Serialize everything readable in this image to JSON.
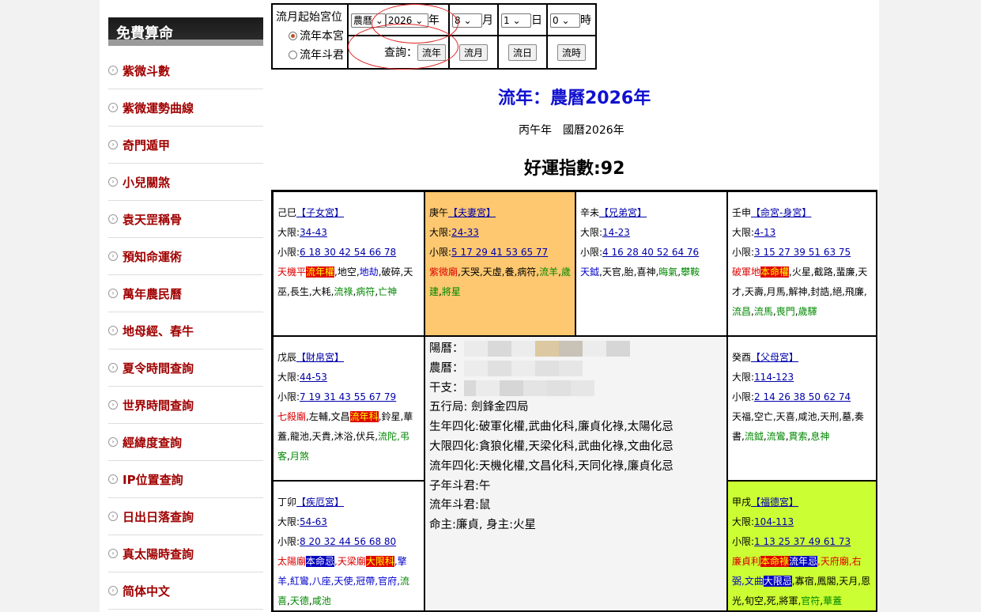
{
  "sidebar": {
    "title": "免費算命",
    "items": [
      "紫微斗數",
      "紫微運勢曲線",
      "奇門遁甲",
      "小兒關煞",
      "袁天罡稱骨",
      "預知命運術",
      "萬年農民曆",
      "地母經、春牛",
      "夏令時間查詢",
      "世界時間查詢",
      "經緯度查詢",
      "IP位置查詢",
      "日出日落查詢",
      "真太陽時查詢",
      "简体中文"
    ]
  },
  "controls": {
    "start_label": "流月起始宮位",
    "radio1": "流年本宮",
    "radio2": "流年斗君",
    "calendar": "農曆",
    "year": "2026",
    "year_unit": "年",
    "month": "8",
    "month_unit": "月",
    "day": "1",
    "day_unit": "日",
    "hour": "0",
    "hour_unit": "時",
    "query_label": "查詢：",
    "btn_year": "流年",
    "btn_month": "流月",
    "btn_day": "流日",
    "btn_hour": "流時"
  },
  "header": {
    "title": "流年：農曆2026年",
    "sub": "丙午年　國曆2026年",
    "score": "好運指數:92"
  },
  "palaces": {
    "p1": {
      "stem": "己巳",
      "name": "【子女宮】",
      "daxian": "34-43",
      "xiaoxian": "6 18 30 42 54 66 78"
    },
    "p2": {
      "stem": "庚午",
      "name": "【夫妻宮】",
      "daxian": "24-33",
      "xiaoxian": "5 17 29 41 53 65 77"
    },
    "p3": {
      "stem": "辛未",
      "name": "【兄弟宮】",
      "daxian": "14-23",
      "xiaoxian": "4 16 28 40 52 64 76"
    },
    "p4": {
      "stem": "壬申",
      "name": "【命宮-身宮】",
      "daxian": "4-13",
      "xiaoxian": "3 15 27 39 51 63 75"
    },
    "p5": {
      "stem": "戊辰",
      "name": "【財帛宮】",
      "daxian": "44-53",
      "xiaoxian": "7 19 31 43 55 67 79"
    },
    "p6": {
      "stem": "癸酉",
      "name": "【父母宮】",
      "daxian": "114-123",
      "xiaoxian": "2 14 26 38 50 62 74"
    },
    "p7": {
      "stem": "丁卯",
      "name": "【疾厄宮】",
      "daxian": "54-63",
      "xiaoxian": "8 20 32 44 56 68 80"
    },
    "p8": {
      "stem": "甲戌",
      "name": "【福德宮】",
      "daxian": "104-113",
      "xiaoxian": "1 13 25 37 49 61 73"
    }
  },
  "labels": {
    "daxian": "大限:",
    "xiaoxian": "小限:"
  },
  "stars": {
    "p1_a": "天機平",
    "p1_b": "流年權",
    "p1_c": ",地空,",
    "p1_d": "地劫",
    "p1_e": ",破碎,天",
    "p1_f": "巫,長生,大耗,",
    "p1_g": "流祿",
    "p1_h": ",",
    "p1_i": "病符",
    "p1_j": ",",
    "p1_k": "亡神",
    "p2_a": "紫微廟",
    "p2_b": ",天哭,天虛,養,病符,",
    "p2_c": "流羊",
    "p2_d": ",",
    "p2_e": "歲建",
    "p2_f": ",",
    "p2_g": "將星",
    "p3_a": "天鉞",
    "p3_b": ",天官,胎,喜神,",
    "p3_c": "晦氣",
    "p3_d": ",",
    "p3_e": "攀鞍",
    "p4_a": "破軍地",
    "p4_b": "本命權",
    "p4_c": ",火星,截路,蜚廉,天",
    "p4_d": "才,天壽,月馬,解神,封誥,絕,飛廉,",
    "p4_e": "流昌",
    "p4_f": ",",
    "p4_g": "流馬",
    "p4_h": ",",
    "p4_i": "喪門",
    "p4_j": ",",
    "p4_k": "歲驛",
    "p5_a": "七殺廟",
    "p5_b": ",左輔,文昌",
    "p5_c": "流年科",
    "p5_d": ",鈴星,華",
    "p5_e": "蓋,龍池,天貴,沐浴,伏兵,",
    "p5_f": "流陀",
    "p5_g": ",弔",
    "p5_h": "客",
    "p5_i": ",",
    "p5_j": "月煞",
    "p6_a": "天福,空亡,天喜,咸池,天刑,墓,奏",
    "p6_b": "書,",
    "p6_c": "流鉞",
    "p6_d": ",",
    "p6_e": "流鸞",
    "p6_f": ",",
    "p6_g": "貫索",
    "p6_h": ",",
    "p6_i": "息神",
    "p7_a": "太陽廟",
    "p7_b": "本命忌",
    "p7_c": ",天梁廟",
    "p7_d": "大限科",
    "p7_e": ",擎",
    "p7_f": "羊,紅鸞,八座,天使,冠帶,官府,",
    "p7_g": "流",
    "p7_h": "喜",
    "p7_i": ",",
    "p7_j": "天德",
    "p7_k": ",",
    "p7_l": "咸池",
    "p8_a": "廉貞利",
    "p8_b": "本命祿",
    "p8_c": "流年忌",
    "p8_d": ",天府廟,右",
    "p8_e": "弼,文曲",
    "p8_f": "大限忌",
    "p8_g": ",寡宿,鳳閣,天月,恩",
    "p8_h": "光,旬空,死,將軍,",
    "p8_i": "官符",
    "p8_j": ",",
    "p8_k": "華蓋"
  },
  "center": {
    "solar": "陽曆：",
    "lunar": "農曆：",
    "ganzhi": "干支：",
    "wuxing": "五行局: 劍鋒金四局",
    "birth_sihua": "生年四化:破軍化權,武曲化科,廉貞化祿,太陽化忌",
    "daxian_sihua": "大限四化:貪狼化權,天梁化科,武曲化祿,文曲化忌",
    "liunian_sihua": "流年四化:天機化權,文昌化科,天同化祿,廉貞化忌",
    "zinian": "子年斗君:午",
    "liunian_doujun": "流年斗君:鼠",
    "mingzhu": "命主:廉貞, 身主:火星"
  },
  "colors": {
    "highlight_orange": "#fdc870",
    "highlight_lime": "#ccff33",
    "link_blue": "#1010c0",
    "sidebar_red": "#a00000"
  }
}
